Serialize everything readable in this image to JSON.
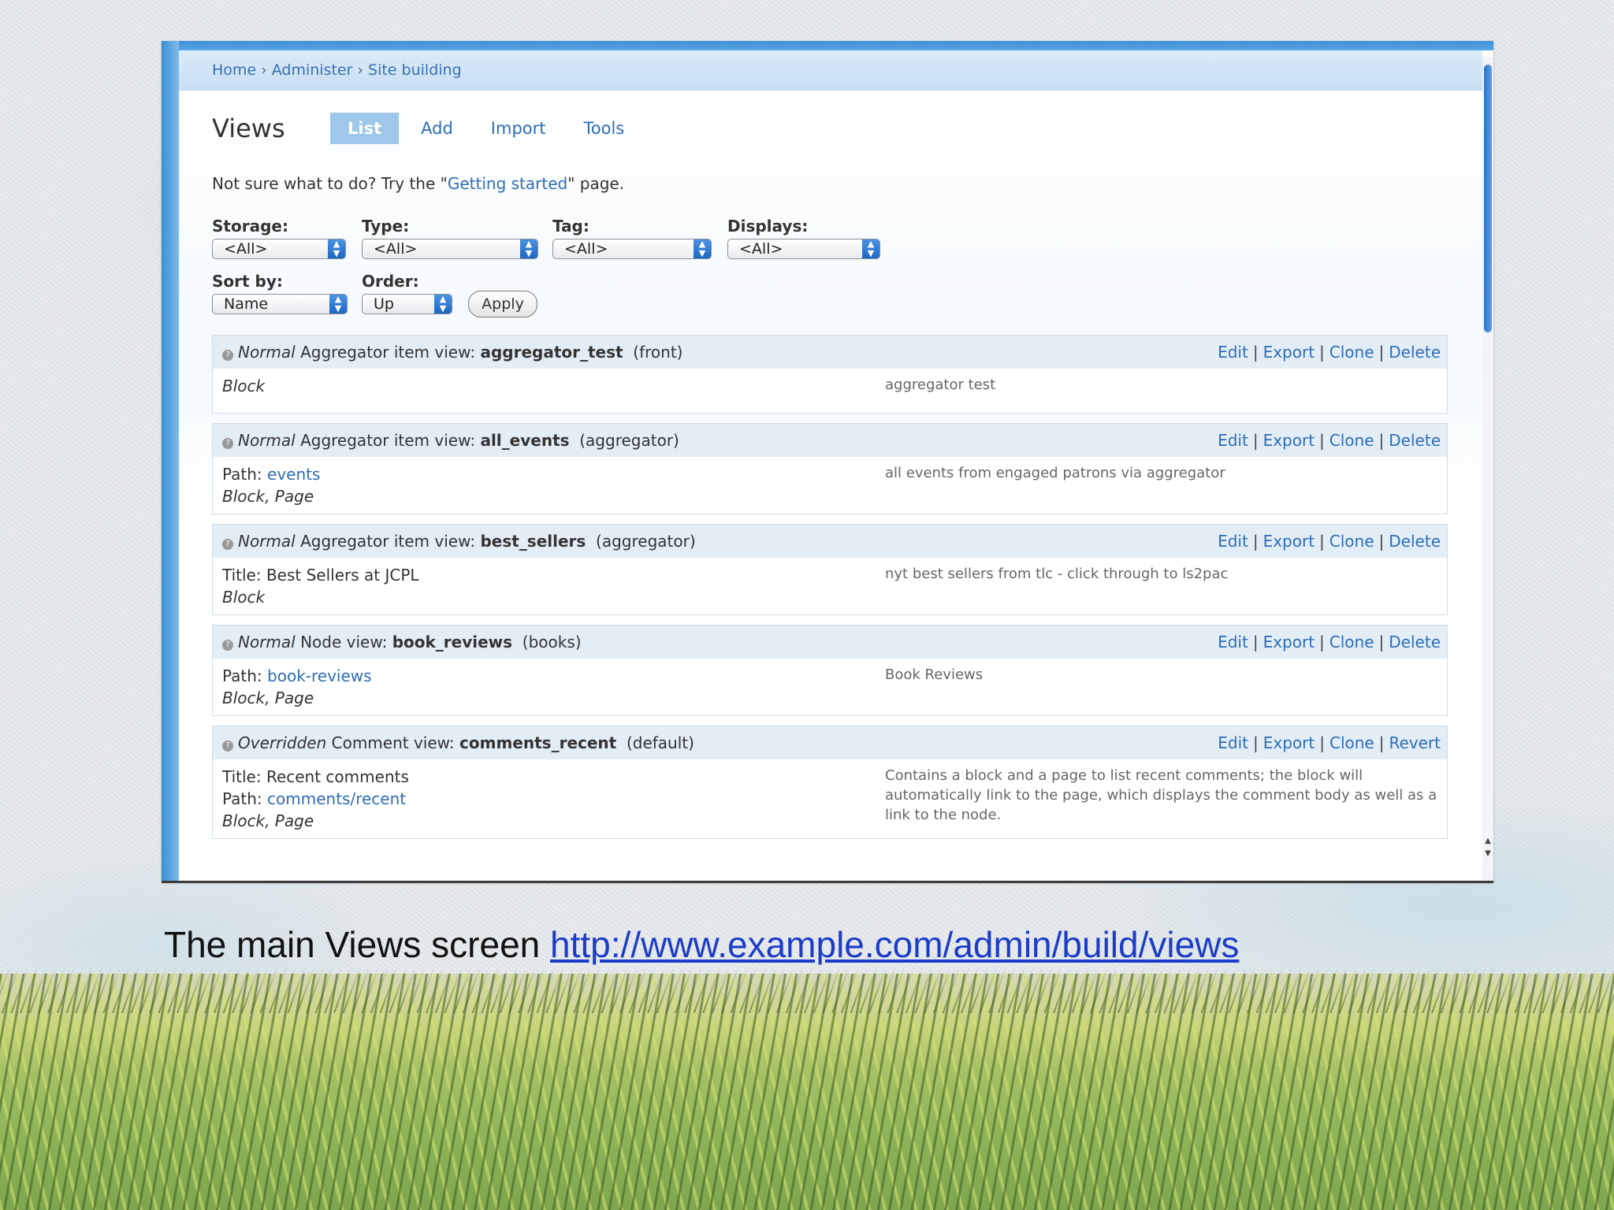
{
  "breadcrumb": [
    "Home",
    "Administer",
    "Site building"
  ],
  "breadcrumb_sep": "›",
  "page_title": "Views",
  "tabs": [
    {
      "label": "List",
      "active": true
    },
    {
      "label": "Add"
    },
    {
      "label": "Import"
    },
    {
      "label": "Tools"
    }
  ],
  "hint": {
    "before": "Not sure what to do? Try the \"",
    "link": "Getting started",
    "after": "\" page."
  },
  "filters": {
    "storage": {
      "label": "Storage:",
      "value": "<All>"
    },
    "type": {
      "label": "Type:",
      "value": "<All>"
    },
    "tag": {
      "label": "Tag:",
      "value": "<All>"
    },
    "displays": {
      "label": "Displays:",
      "value": "<All>"
    },
    "sort_by": {
      "label": "Sort by:",
      "value": "Name"
    },
    "order": {
      "label": "Order:",
      "value": "Up"
    },
    "apply_label": "Apply"
  },
  "views": [
    {
      "status": "Normal",
      "kind": "Aggregator item view:",
      "name": "aggregator_test",
      "tag": "(front)",
      "ops": [
        "Edit",
        "Export",
        "Clone",
        "Delete"
      ],
      "lines": [
        {
          "text": "Block",
          "italic": true
        }
      ],
      "description": "aggregator test"
    },
    {
      "status": "Normal",
      "kind": "Aggregator item view:",
      "name": "all_events",
      "tag": "(aggregator)",
      "ops": [
        "Edit",
        "Export",
        "Clone",
        "Delete"
      ],
      "lines": [
        {
          "prefix": "Path: ",
          "link": "events"
        },
        {
          "text": "Block, Page",
          "italic": true
        }
      ],
      "description": "all events from engaged patrons via aggregator"
    },
    {
      "status": "Normal",
      "kind": "Aggregator item view:",
      "name": "best_sellers",
      "tag": "(aggregator)",
      "ops": [
        "Edit",
        "Export",
        "Clone",
        "Delete"
      ],
      "lines": [
        {
          "text": "Title: Best Sellers at JCPL"
        },
        {
          "text": "Block",
          "italic": true
        }
      ],
      "description": "nyt best sellers from tlc - click through to ls2pac"
    },
    {
      "status": "Normal",
      "kind": "Node view:",
      "name": "book_reviews",
      "tag": "(books)",
      "ops": [
        "Edit",
        "Export",
        "Clone",
        "Delete"
      ],
      "lines": [
        {
          "prefix": "Path: ",
          "link": "book-reviews"
        },
        {
          "text": "Block, Page",
          "italic": true
        }
      ],
      "description": "Book Reviews"
    },
    {
      "status": "Overridden",
      "kind": "Comment view:",
      "name": "comments_recent",
      "tag": "(default)",
      "ops": [
        "Edit",
        "Export",
        "Clone",
        "Revert"
      ],
      "lines": [
        {
          "text": "Title: Recent comments"
        },
        {
          "prefix": "Path: ",
          "link": "comments/recent"
        },
        {
          "text": "Block, Page",
          "italic": true
        }
      ],
      "description": "Contains a block and a page to list recent comments; the block will automatically link to the page, which displays the comment body as well as a link to the node."
    }
  ],
  "caption": {
    "text": "The main Views screen ",
    "link": "http://www.example.com/admin/build/views"
  },
  "colors": {
    "link": "#2f6db5",
    "tab_active_bg": "#9fc7ea",
    "view_header_bg": "#e2edf6",
    "frame_blue": "#3c8fd6"
  }
}
